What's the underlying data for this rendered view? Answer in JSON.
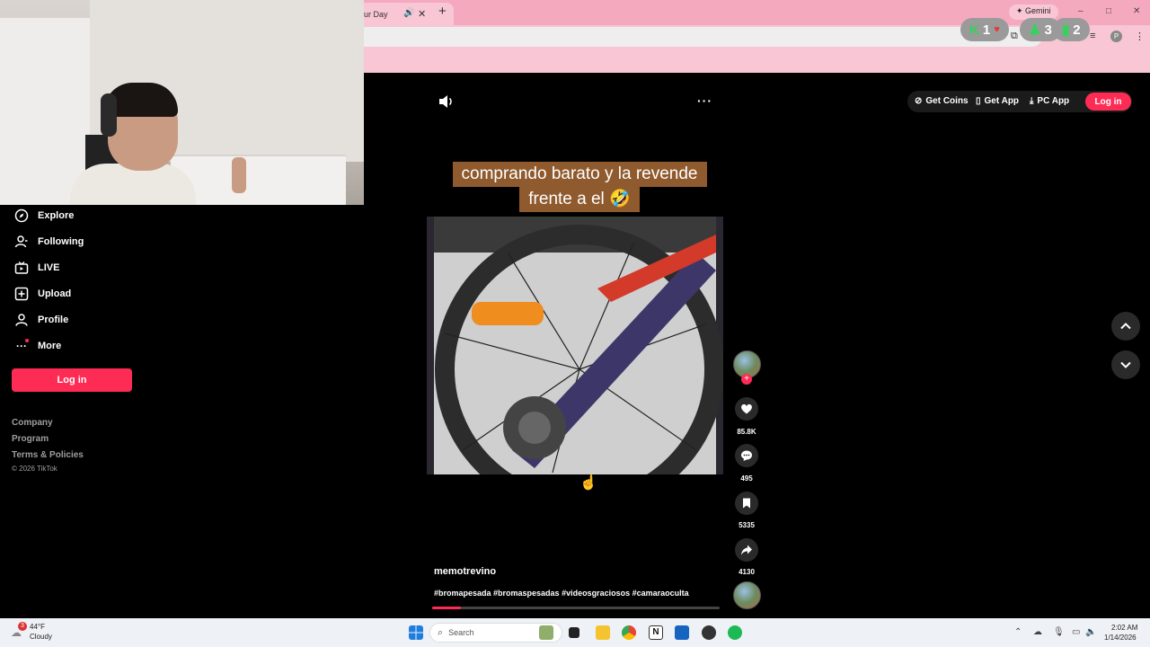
{
  "browser": {
    "tab_title": "ur Day",
    "gemini_label": "Gemini",
    "window_controls": [
      "–",
      "□",
      "✕"
    ],
    "profile_initial": "P"
  },
  "stream_stats": [
    {
      "icon": "k-icon",
      "value": "1",
      "color": "#35d35a"
    },
    {
      "icon": "person-icon",
      "value": "3",
      "color": "#35d35a"
    },
    {
      "icon": "bars-icon",
      "value": "2",
      "color": "#35d35a"
    }
  ],
  "sidebar": {
    "items": [
      {
        "label": "Explore",
        "icon": "compass-icon"
      },
      {
        "label": "Following",
        "icon": "following-icon"
      },
      {
        "label": "LIVE",
        "icon": "live-tv-icon"
      },
      {
        "label": "Upload",
        "icon": "upload-icon"
      },
      {
        "label": "Profile",
        "icon": "profile-icon"
      },
      {
        "label": "More",
        "icon": "more-icon"
      }
    ],
    "login_label": "Log in",
    "footer_links": [
      "Company",
      "Program",
      "Terms & Policies"
    ],
    "copyright": "© 2026 TikTok"
  },
  "header": {
    "get_coins": "Get Coins",
    "get_app": "Get App",
    "pc_app": "PC App",
    "login": "Log in"
  },
  "video": {
    "caption_line1": "comprando barato y la revende",
    "caption_line2": "frente a el 🤣",
    "username": "memotrevino",
    "hashtags": "#bromapesada #bromaspesadas #videosgraciosos #camaraoculta",
    "progress": 0.1
  },
  "actions": {
    "likes": "85.8K",
    "comments": "495",
    "saves": "5335",
    "shares": "4130"
  },
  "taskbar": {
    "temperature": "44°F",
    "weather": "Cloudy",
    "weather_badge": "3",
    "search_placeholder": "Search",
    "time": "2:02 AM",
    "date": "1/14/2026"
  },
  "colors": {
    "accent": "#fe2c55",
    "caption_bg": "#8f5a2d",
    "chrome_bg": "#f8c6d4"
  }
}
